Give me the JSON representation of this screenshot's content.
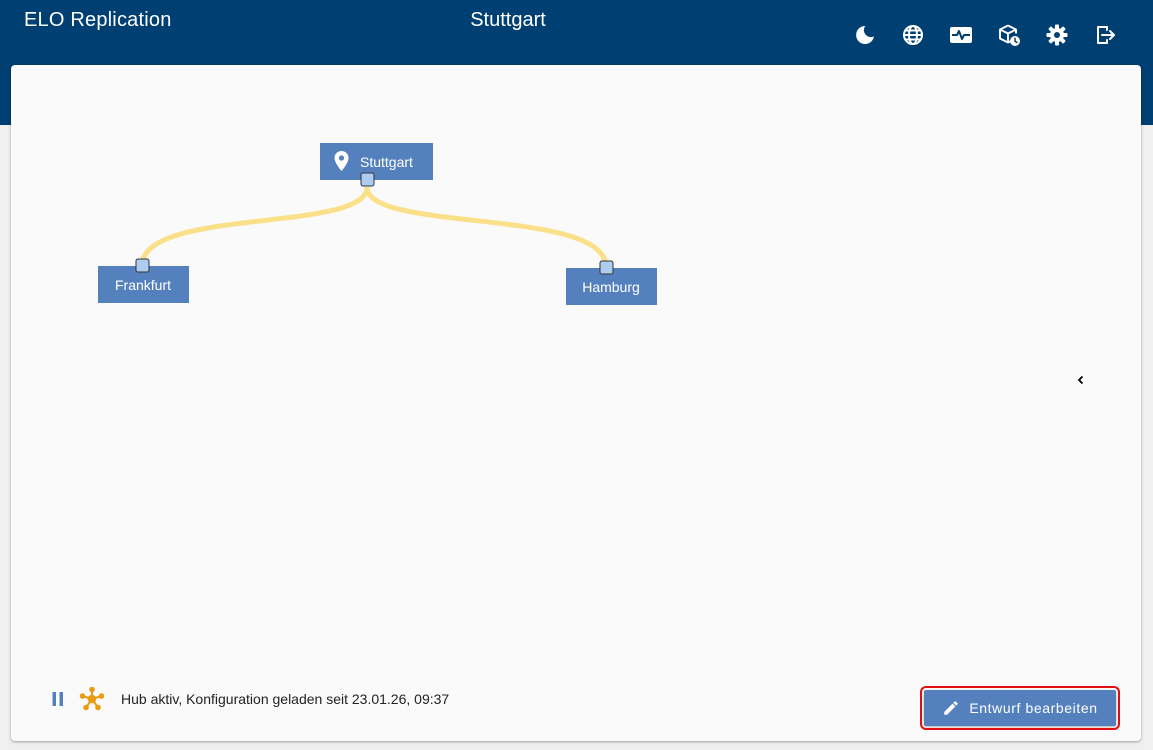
{
  "header": {
    "app_title": "ELO Replication",
    "location_title": "Stuttgart",
    "background_color": "#003f72",
    "toolbar": [
      {
        "name": "dark-mode-button",
        "icon": "moon-icon"
      },
      {
        "name": "language-button",
        "icon": "globe-icon"
      },
      {
        "name": "monitoring-button",
        "icon": "heartbeat-icon"
      },
      {
        "name": "schedule-button",
        "icon": "package-clock-icon"
      },
      {
        "name": "settings-button",
        "icon": "gear-icon"
      },
      {
        "name": "logout-button",
        "icon": "logout-icon"
      }
    ]
  },
  "diagram": {
    "nodes": [
      {
        "id": "stuttgart",
        "label": "Stuttgart",
        "icon": "map-marker-icon"
      },
      {
        "id": "frankfurt",
        "label": "Frankfurt"
      },
      {
        "id": "hamburg",
        "label": "Hamburg"
      }
    ],
    "edges": [
      {
        "from": "stuttgart",
        "to": "frankfurt"
      },
      {
        "from": "stuttgart",
        "to": "hamburg"
      }
    ],
    "node_color": "#5481bd",
    "port_color": "#aecbf2",
    "edge_color": "#fbe08a"
  },
  "side_panel": {
    "toggle_icon": "chevron-left-icon"
  },
  "status": {
    "pause_icon": "pause-icon",
    "hub_icon": "hub-icon",
    "text": "Hub aktiv, Konfiguration geladen seit 23.01.26, 09:37"
  },
  "edit_button": {
    "label": "Entwurf bearbeiten",
    "icon": "pencil-icon",
    "color": "#5481bd"
  }
}
